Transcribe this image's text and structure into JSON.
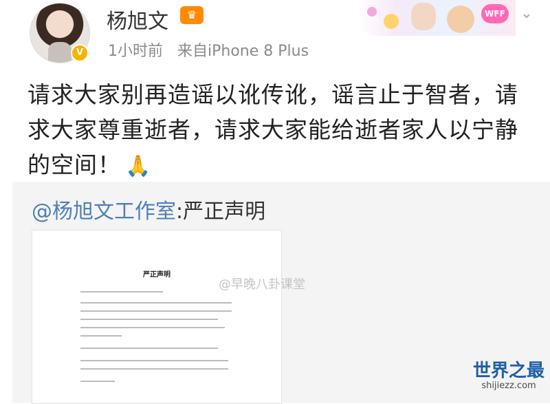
{
  "post": {
    "username": "杨旭文",
    "time": "1小时前",
    "source": "来自iPhone 8 Plus",
    "text": "请求大家别再造谣以讹传讹，谣言止于智者，请求大家尊重逝者，请求大家能给逝者家人以宁静的空间！",
    "emoji": "🙏"
  },
  "banner": {
    "badge": "WFF"
  },
  "repost": {
    "mention": "@杨旭文工作室",
    "suffix": ":严正声明",
    "doc_title": "严正声明",
    "watermark": "@早晚八卦课堂"
  },
  "site": {
    "name_zh": "世界之最",
    "name_en": "shijiezz.com"
  }
}
